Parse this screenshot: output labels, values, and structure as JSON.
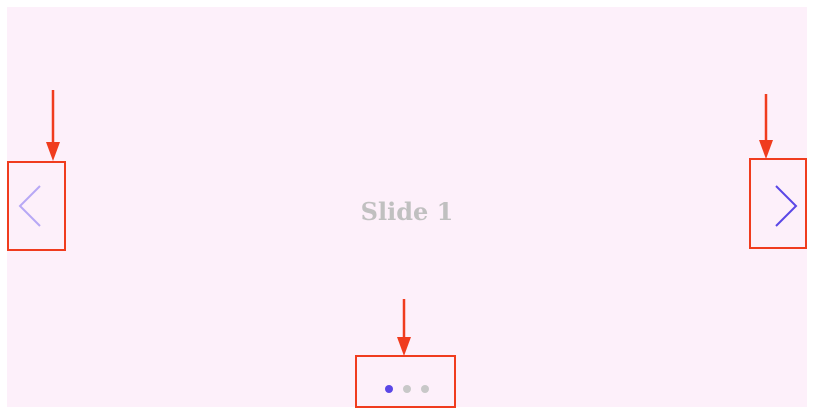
{
  "carousel": {
    "slide_label": "Slide 1",
    "active_index": 1,
    "dots_count": 3,
    "dots": [
      {
        "active": true
      },
      {
        "active": false
      },
      {
        "active": false
      }
    ],
    "prev_icon": "chevron-left-icon",
    "next_icon": "chevron-right-icon"
  },
  "colors": {
    "slide_background": "#fdf0fa",
    "slide_label": "#c0c0c0",
    "accent": "#5a47e6",
    "prev_arrow": "#b7a8f5",
    "inactive_dot": "#c8c8c8",
    "callout": "#f03c1e"
  }
}
